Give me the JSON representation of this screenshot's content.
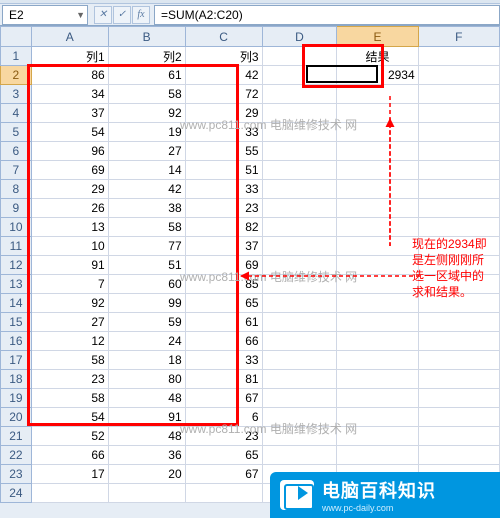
{
  "namebox_value": "E2",
  "formula_value": "=SUM(A2:C20)",
  "fx_label": "fx",
  "columns": [
    "A",
    "B",
    "C",
    "D",
    "E",
    "F"
  ],
  "row_count": 24,
  "headers": {
    "A": "列1",
    "B": "列2",
    "C": "列3",
    "E": "结果"
  },
  "result_value": "2934",
  "selected_cell": "E2",
  "selected_col_index": 4,
  "selected_row_index": 1,
  "chart_data": {
    "type": "table",
    "columns": [
      "列1",
      "列2",
      "列3"
    ],
    "rows": [
      [
        86,
        61,
        42
      ],
      [
        34,
        58,
        72
      ],
      [
        37,
        92,
        29
      ],
      [
        54,
        19,
        33
      ],
      [
        96,
        27,
        55
      ],
      [
        69,
        14,
        51
      ],
      [
        29,
        42,
        33
      ],
      [
        26,
        38,
        23
      ],
      [
        13,
        58,
        82
      ],
      [
        10,
        77,
        37
      ],
      [
        91,
        51,
        69
      ],
      [
        7,
        60,
        85
      ],
      [
        92,
        99,
        65
      ],
      [
        27,
        59,
        61
      ],
      [
        12,
        24,
        66
      ],
      [
        58,
        18,
        33
      ],
      [
        23,
        80,
        81
      ],
      [
        58,
        48,
        67
      ],
      [
        54,
        91,
        6
      ],
      [
        52,
        48,
        23
      ],
      [
        66,
        36,
        65
      ],
      [
        17,
        20,
        67
      ]
    ],
    "selection_range": "A2:C20",
    "sum_result": 2934
  },
  "watermarks": [
    "www.pc811.com\n电脑维修技术 网",
    "www.pc811.com\n电脑维修技术 网",
    "www.pc811.com\n电脑维修技术 网"
  ],
  "annotation_text": "现在的2934即是左侧刚刚所选一区域中的求和结果。",
  "logo_text": "电脑百科知识",
  "logo_sub": "www.pc-daily.com"
}
